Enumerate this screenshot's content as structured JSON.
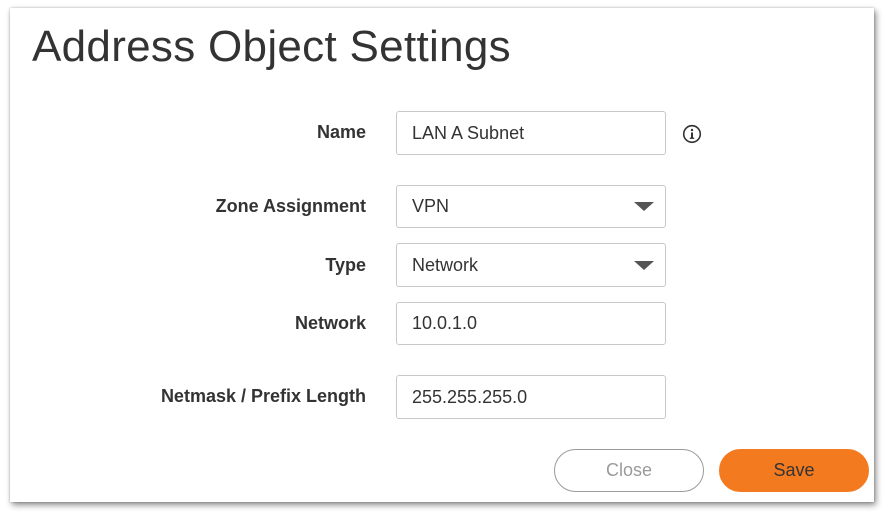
{
  "dialog": {
    "title": "Address Object Settings"
  },
  "form": {
    "name": {
      "label": "Name",
      "value": "LAN A Subnet"
    },
    "zone": {
      "label": "Zone Assignment",
      "value": "VPN"
    },
    "type": {
      "label": "Type",
      "value": "Network"
    },
    "network": {
      "label": "Network",
      "value": "10.0.1.0"
    },
    "netmask": {
      "label": "Netmask / Prefix Length",
      "value": "255.255.255.0"
    }
  },
  "icons": {
    "info": "info-icon",
    "dropdown": "chevron-down-icon"
  },
  "buttons": {
    "close_label": "Close",
    "save_label": "Save"
  },
  "colors": {
    "accent": "#f47a20",
    "text": "#333333",
    "border": "#c8c8c8",
    "close_text": "#9a9a9a"
  }
}
